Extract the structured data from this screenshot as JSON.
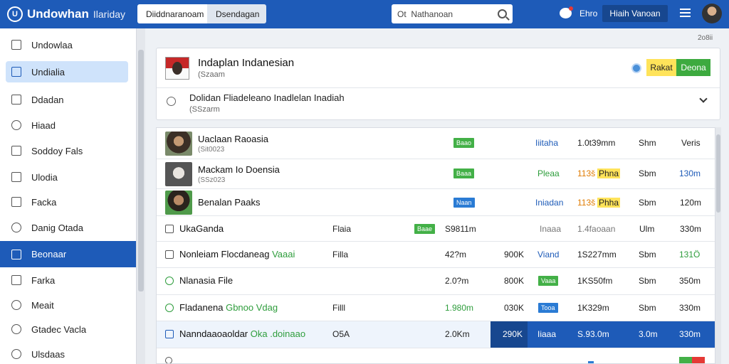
{
  "header": {
    "brand_logo": "U",
    "title": "Undowhan",
    "subtitle": "Ilariday",
    "seg_left": "Diiddnaranoam",
    "seg_right": "Dsendagan",
    "search_value": "Ot  Nathanoan",
    "link": "Ehro",
    "button": "Hiaih Vanoan"
  },
  "sidebar": {
    "items": [
      {
        "label": "Undowlaa"
      },
      {
        "label": "Undialia"
      },
      {
        "label": "Ddadan"
      },
      {
        "label": "Hiaad"
      },
      {
        "label": "Soddoy Fals"
      },
      {
        "label": "Ulodia"
      },
      {
        "label": "Facka"
      },
      {
        "label": "Danig Otada"
      },
      {
        "label": "Beonaar"
      },
      {
        "label": "Farka"
      },
      {
        "label": "Meait"
      },
      {
        "label": "Gtadec Vacla"
      },
      {
        "label": "Ulsdaas"
      }
    ]
  },
  "corner_note": "2o8ii",
  "card": {
    "title": "Indaplan Indanesian",
    "sub": "(Szaam",
    "btn_yellow": "Rakat",
    "btn_green": "Deona",
    "line2_title": "Dolidan Fliadeleano Inadlelan Inadiah",
    "line2_sub": "(SSzarm"
  },
  "rows": [
    {
      "name": "Uaclaan Raoasia",
      "sub": "(Sit0023",
      "badge": "Baao",
      "c1": "Iiitaha",
      "c2": "1.0t39mm",
      "c3": "Shm",
      "c4": "Veris"
    },
    {
      "name": "Mackam Io Doensia",
      "sub": "(SSz023",
      "badge": "Baaa",
      "c1": "Pleaa",
      "c2a": "113š",
      "c2b": "Phna",
      "c3": "Sbm",
      "c4": "130m"
    },
    {
      "name": "Benalan Paaks",
      "badge": "Naan",
      "c1": "Iniadan",
      "c2a": "113š",
      "c2b": "Phha",
      "c3": "Sbm",
      "c4": "120m"
    },
    {
      "label": "UkaGanda",
      "c0": "Flaia",
      "badge": "Baae",
      "c1": "S9811m",
      "c2": "Inaaa",
      "c3": "1.4faoaan",
      "c4": "Ulm",
      "c5": "330m"
    },
    {
      "label_a": "Nonleiam Flocdaneag",
      "label_b": "Vaaai",
      "c0": "Filla",
      "c1": "42?m",
      "c2": "900K",
      "c3": "Viand",
      "c4": "1S227mm",
      "c5": "Sbm",
      "c6": "131Ö"
    },
    {
      "label": "Nlanasia File",
      "c1": "2.0?m",
      "c2": "800K",
      "badge": "Vaaa",
      "c4": "1KS50fm",
      "c5": "Sbm",
      "c6": "350m"
    },
    {
      "label_a": "Fladanena",
      "label_b": "Gbnoo Vdag",
      "c0": "Filll",
      "c1": "1.980m",
      "c2": "030K",
      "badge": "Tooa",
      "c4": "1K329m",
      "c5": "Sbm",
      "c6": "330m"
    },
    {
      "label_a": "Nanndaaoaoldar",
      "label_b": "Oka .doinaao",
      "c0": "O5A",
      "c1": "2.0Km",
      "c2": "290K",
      "c3": "Iiaaa",
      "c4": "S.93.0m",
      "c5": "3.0m",
      "c6": "330m"
    }
  ],
  "colors": {
    "accent": "#1e5bb8",
    "green": "#43b047",
    "yellow": "#ffe35a"
  }
}
